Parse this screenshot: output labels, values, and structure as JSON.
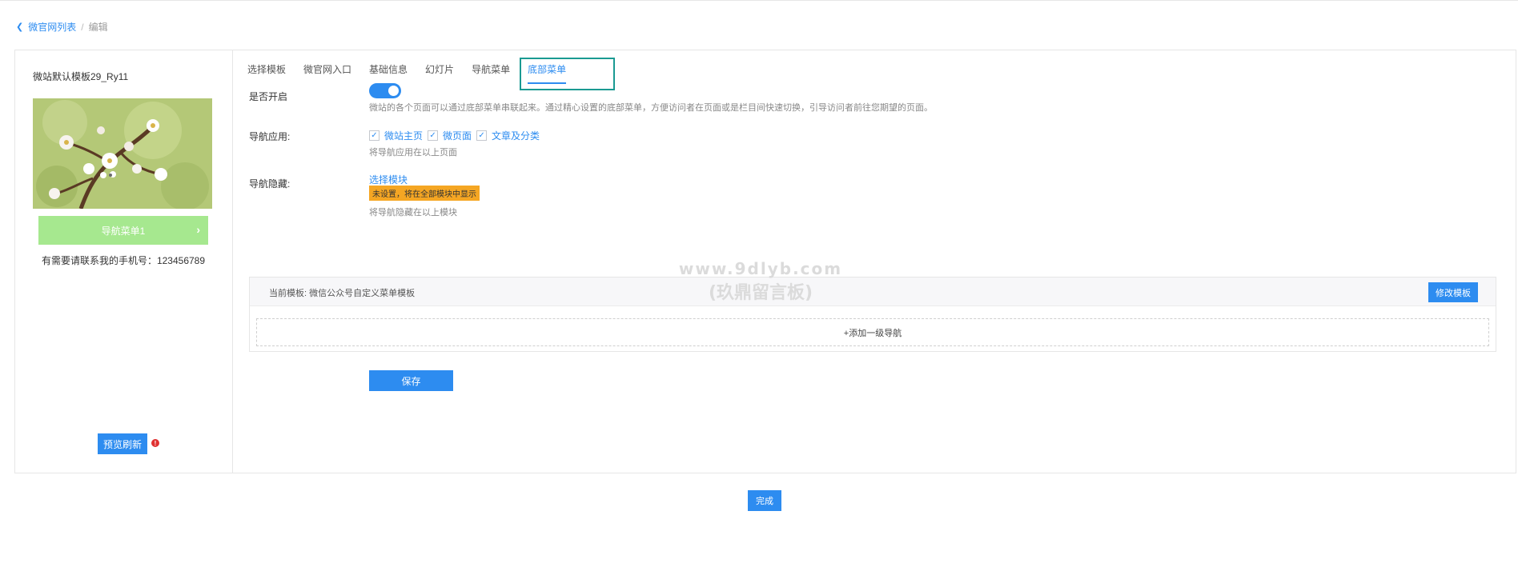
{
  "breadcrumb": {
    "back_icon": "chevron-left-icon",
    "parent": "微官网列表",
    "separator": "/",
    "current": "编辑"
  },
  "preview": {
    "template_name": "微站默认模板29_Ry11",
    "nav_bar_label": "导航菜单1",
    "nav_bar_color": "#a6e88f",
    "phone_text": "有需要请联系我的手机号：123456789",
    "refresh_label": "预览刷新",
    "warn_icon_char": "!"
  },
  "tabs": [
    {
      "label": "选择模板",
      "active": false
    },
    {
      "label": "微官网入口",
      "active": false
    },
    {
      "label": "基础信息",
      "active": false
    },
    {
      "label": "幻灯片",
      "active": false
    },
    {
      "label": "导航菜单",
      "active": false
    },
    {
      "label": "底部菜单",
      "active": true
    }
  ],
  "form": {
    "enable": {
      "label": "是否开启",
      "on": true,
      "description": "微站的各个页面可以通过底部菜单串联起来。通过精心设置的底部菜单，方便访问者在页面或是栏目间快速切换，引导访问者前往您期望的页面。"
    },
    "nav_apply": {
      "label": "导航应用:",
      "options": [
        {
          "label": "微站主页",
          "checked": true
        },
        {
          "label": "微页面",
          "checked": true
        },
        {
          "label": "文章及分类",
          "checked": true
        }
      ],
      "hint": "将导航应用在以上页面"
    },
    "nav_hide": {
      "label": "导航隐藏:",
      "select_link": "选择模块",
      "badge": "未设置，将在全部模块中显示",
      "hint": "将导航隐藏在以上模块"
    }
  },
  "template_box": {
    "current_label": "当前模板: 微信公众号自定义菜单模板",
    "edit_label": "修改模板",
    "add_nav_label": "+添加一级导航"
  },
  "save_label": "保存",
  "done_label": "完成",
  "watermark": {
    "line1": "www.9dlyb.com",
    "line2": "(玖鼎留言板)"
  },
  "colors": {
    "accent": "#2d8cf0",
    "highlight_border": "#1a9a92",
    "warn_badge": "#f5a623"
  }
}
